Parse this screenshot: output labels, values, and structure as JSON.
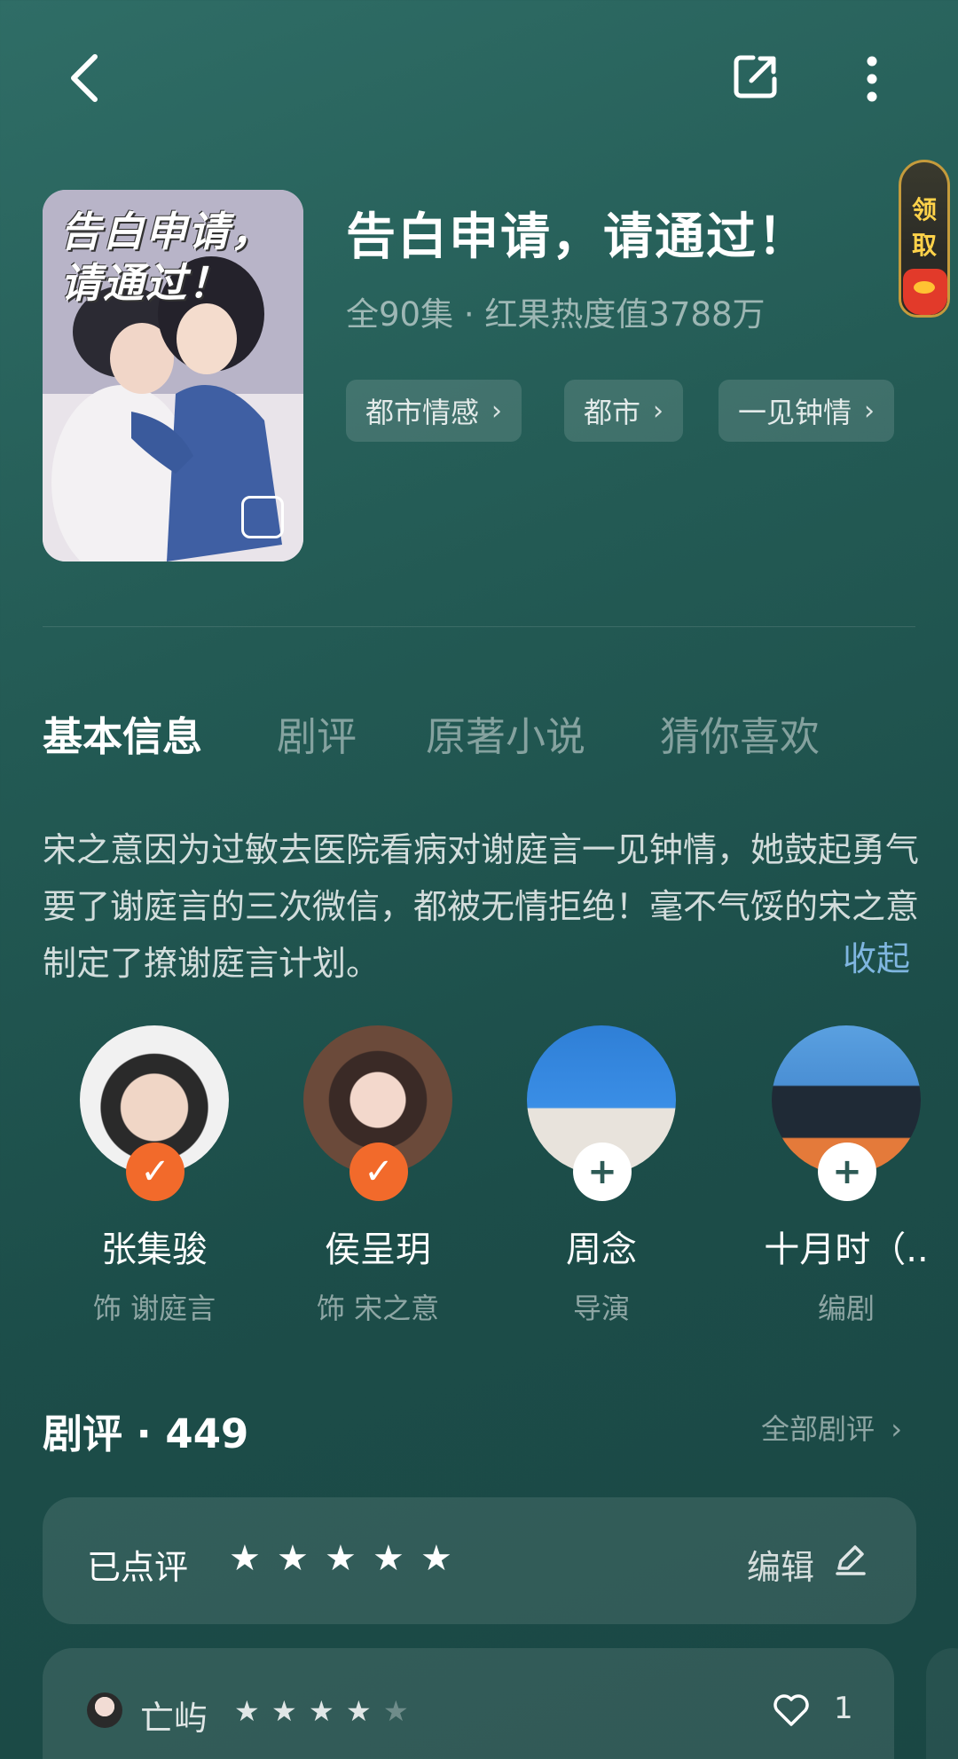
{
  "top_bar": {
    "back_icon": "chevron-left-icon",
    "share_icon": "share-icon",
    "more_icon": "more-vertical-icon"
  },
  "show": {
    "cover_title": "告白申请，请通过！",
    "title": "告白申请，请通过！",
    "meta": "全90集 · 红果热度值3788万",
    "genres": [
      "都市情感",
      "都市",
      "一见钟情"
    ]
  },
  "float_badge": {
    "text": "领取"
  },
  "tabs": [
    "基本信息",
    "剧评",
    "原著小说",
    "猜你喜欢"
  ],
  "description": "宋之意因为过敏去医院看病对谢庭言一见钟情，她鼓起勇气要了谢庭言的三次微信，都被无情拒绝！毫不气馁的宋之意制定了撩谢庭言计划。",
  "collapse_label": "收起",
  "cast": [
    {
      "name": "张集骏",
      "role": "饰 谢庭言",
      "followed": true
    },
    {
      "name": "侯呈玥",
      "role": "饰 宋之意",
      "followed": true
    },
    {
      "name": "周念",
      "role": "导演",
      "followed": false
    },
    {
      "name": "十月时（..",
      "role": "编剧",
      "followed": false
    }
  ],
  "reviews": {
    "title": "剧评 · 449",
    "all_label": "全部剧评",
    "mine": {
      "label": "已点评",
      "rating": 5,
      "edit_label": "编辑"
    },
    "first": {
      "user": "亡屿",
      "rating": 4,
      "likes": "1"
    }
  },
  "colors": {
    "accent_orange": "#f26a2b",
    "link_blue": "#7fb6e0",
    "bg": "#235a54"
  }
}
